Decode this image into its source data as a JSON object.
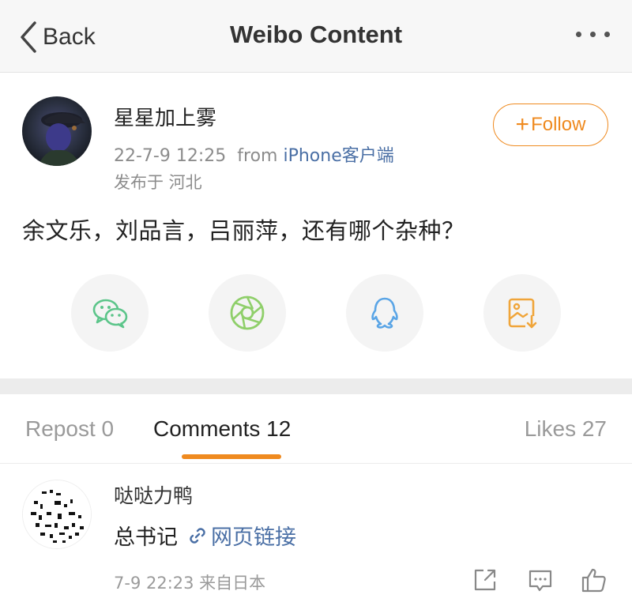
{
  "nav": {
    "back_label": "Back",
    "title": "Weibo Content"
  },
  "post": {
    "author": "星星加上雾",
    "time": "22-7-9 12:25",
    "from_prefix": "from",
    "source": "iPhone客户端",
    "location": "发布于 河北",
    "follow_label": "Follow",
    "content": "余文乐，刘品言，吕丽萍，还有哪个杂种？",
    "share_icons": [
      "wechat-icon",
      "moments-icon",
      "qq-icon",
      "save-image-icon"
    ]
  },
  "tabs": {
    "repost": "Repost 0",
    "comments": "Comments 12",
    "likes": "Likes 27"
  },
  "comment": {
    "author": "哒哒力鸭",
    "text": "总书记",
    "link_label": "网页链接",
    "time": "7-9 22:23 来自日本",
    "actions": [
      "share-icon",
      "reply-icon",
      "like-icon"
    ]
  },
  "colors": {
    "accent": "#ef8a1f",
    "link": "#4a6fa5",
    "wechat": "#5cc58a",
    "moments": "#8fcf6a",
    "qq": "#5aa5e6",
    "save": "#f0a53a"
  }
}
